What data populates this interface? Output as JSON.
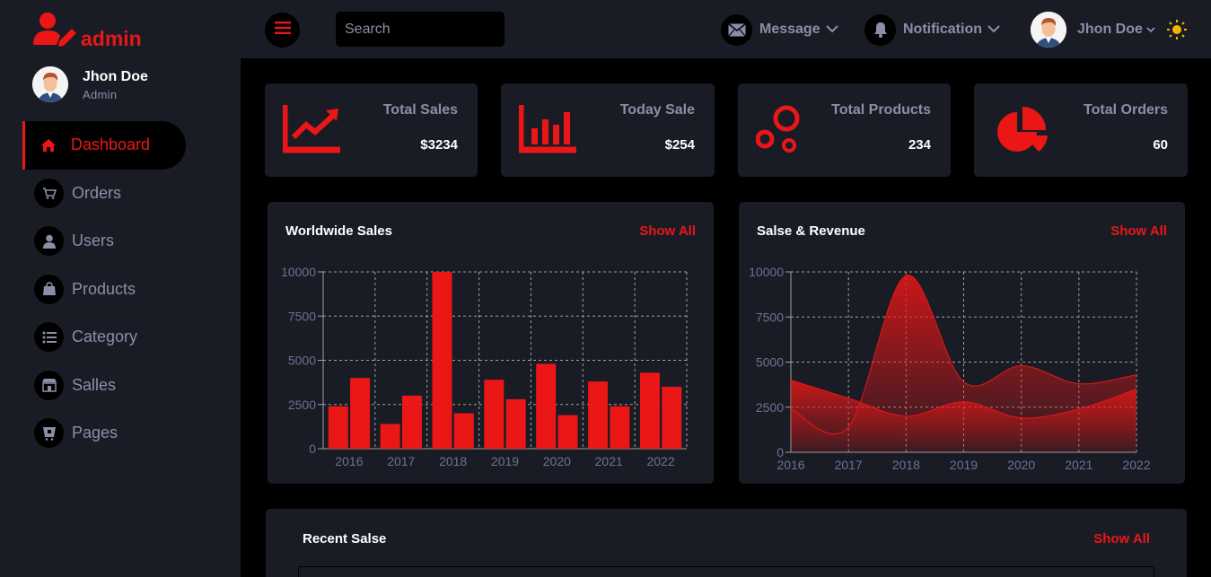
{
  "brand": {
    "name": "admin"
  },
  "user": {
    "name": "Jhon Doe",
    "role": "Admin"
  },
  "sidebar": {
    "items": [
      {
        "label": "Dashboard",
        "icon": "home-icon",
        "active": true
      },
      {
        "label": "Orders",
        "icon": "cart-icon"
      },
      {
        "label": "Users",
        "icon": "user-icon"
      },
      {
        "label": "Products",
        "icon": "bag-icon"
      },
      {
        "label": "Category",
        "icon": "list-icon"
      },
      {
        "label": "Salles",
        "icon": "store-icon"
      },
      {
        "label": "Pages",
        "icon": "file-icon"
      }
    ]
  },
  "topbar": {
    "search_placeholder": "Search",
    "message_label": "Message",
    "notification_label": "Notification",
    "user_label": "Jhon Doe"
  },
  "stats": [
    {
      "title": "Total Sales",
      "value": "$3234",
      "icon": "line-chart-icon"
    },
    {
      "title": "Today Sale",
      "value": "$254",
      "icon": "bar-chart-icon"
    },
    {
      "title": "Total Products",
      "value": "234",
      "icon": "bubbles-icon"
    },
    {
      "title": "Total Orders",
      "value": "60",
      "icon": "pie-chart-icon"
    }
  ],
  "panels": {
    "worldwide_title": "Worldwide Sales",
    "revenue_title": "Salse & Revenue",
    "recent_title": "Recent Salse",
    "show_all": "Show All"
  },
  "colors": {
    "accent": "#eb1616",
    "panel": "#191c24",
    "background": "#000000",
    "muted": "#8a8fa8"
  },
  "chart_data": [
    {
      "type": "bar",
      "title": "Worldwide Sales",
      "categories": [
        "2016",
        "2017",
        "2018",
        "2019",
        "2020",
        "2021",
        "2022"
      ],
      "series": [
        {
          "values": [
            2400,
            1400,
            10000,
            3900,
            4800,
            3800,
            4300
          ]
        },
        {
          "values": [
            4000,
            3000,
            2000,
            2800,
            1900,
            2400,
            3500
          ]
        }
      ],
      "ylim": [
        0,
        10000
      ],
      "yticks": [
        0,
        2500,
        5000,
        7500,
        10000
      ],
      "grid": true
    },
    {
      "type": "area",
      "title": "Salse & Revenue",
      "x": [
        "2016",
        "2017",
        "2018",
        "2019",
        "2020",
        "2021",
        "2022"
      ],
      "series": [
        {
          "values": [
            4000,
            3000,
            2000,
            2800,
            1900,
            2400,
            3500
          ]
        },
        {
          "values": [
            2400,
            1400,
            9800,
            3900,
            4800,
            3800,
            4300
          ]
        }
      ],
      "ylim": [
        0,
        10000
      ],
      "yticks": [
        0,
        2500,
        5000,
        7500,
        10000
      ],
      "grid": true
    }
  ]
}
